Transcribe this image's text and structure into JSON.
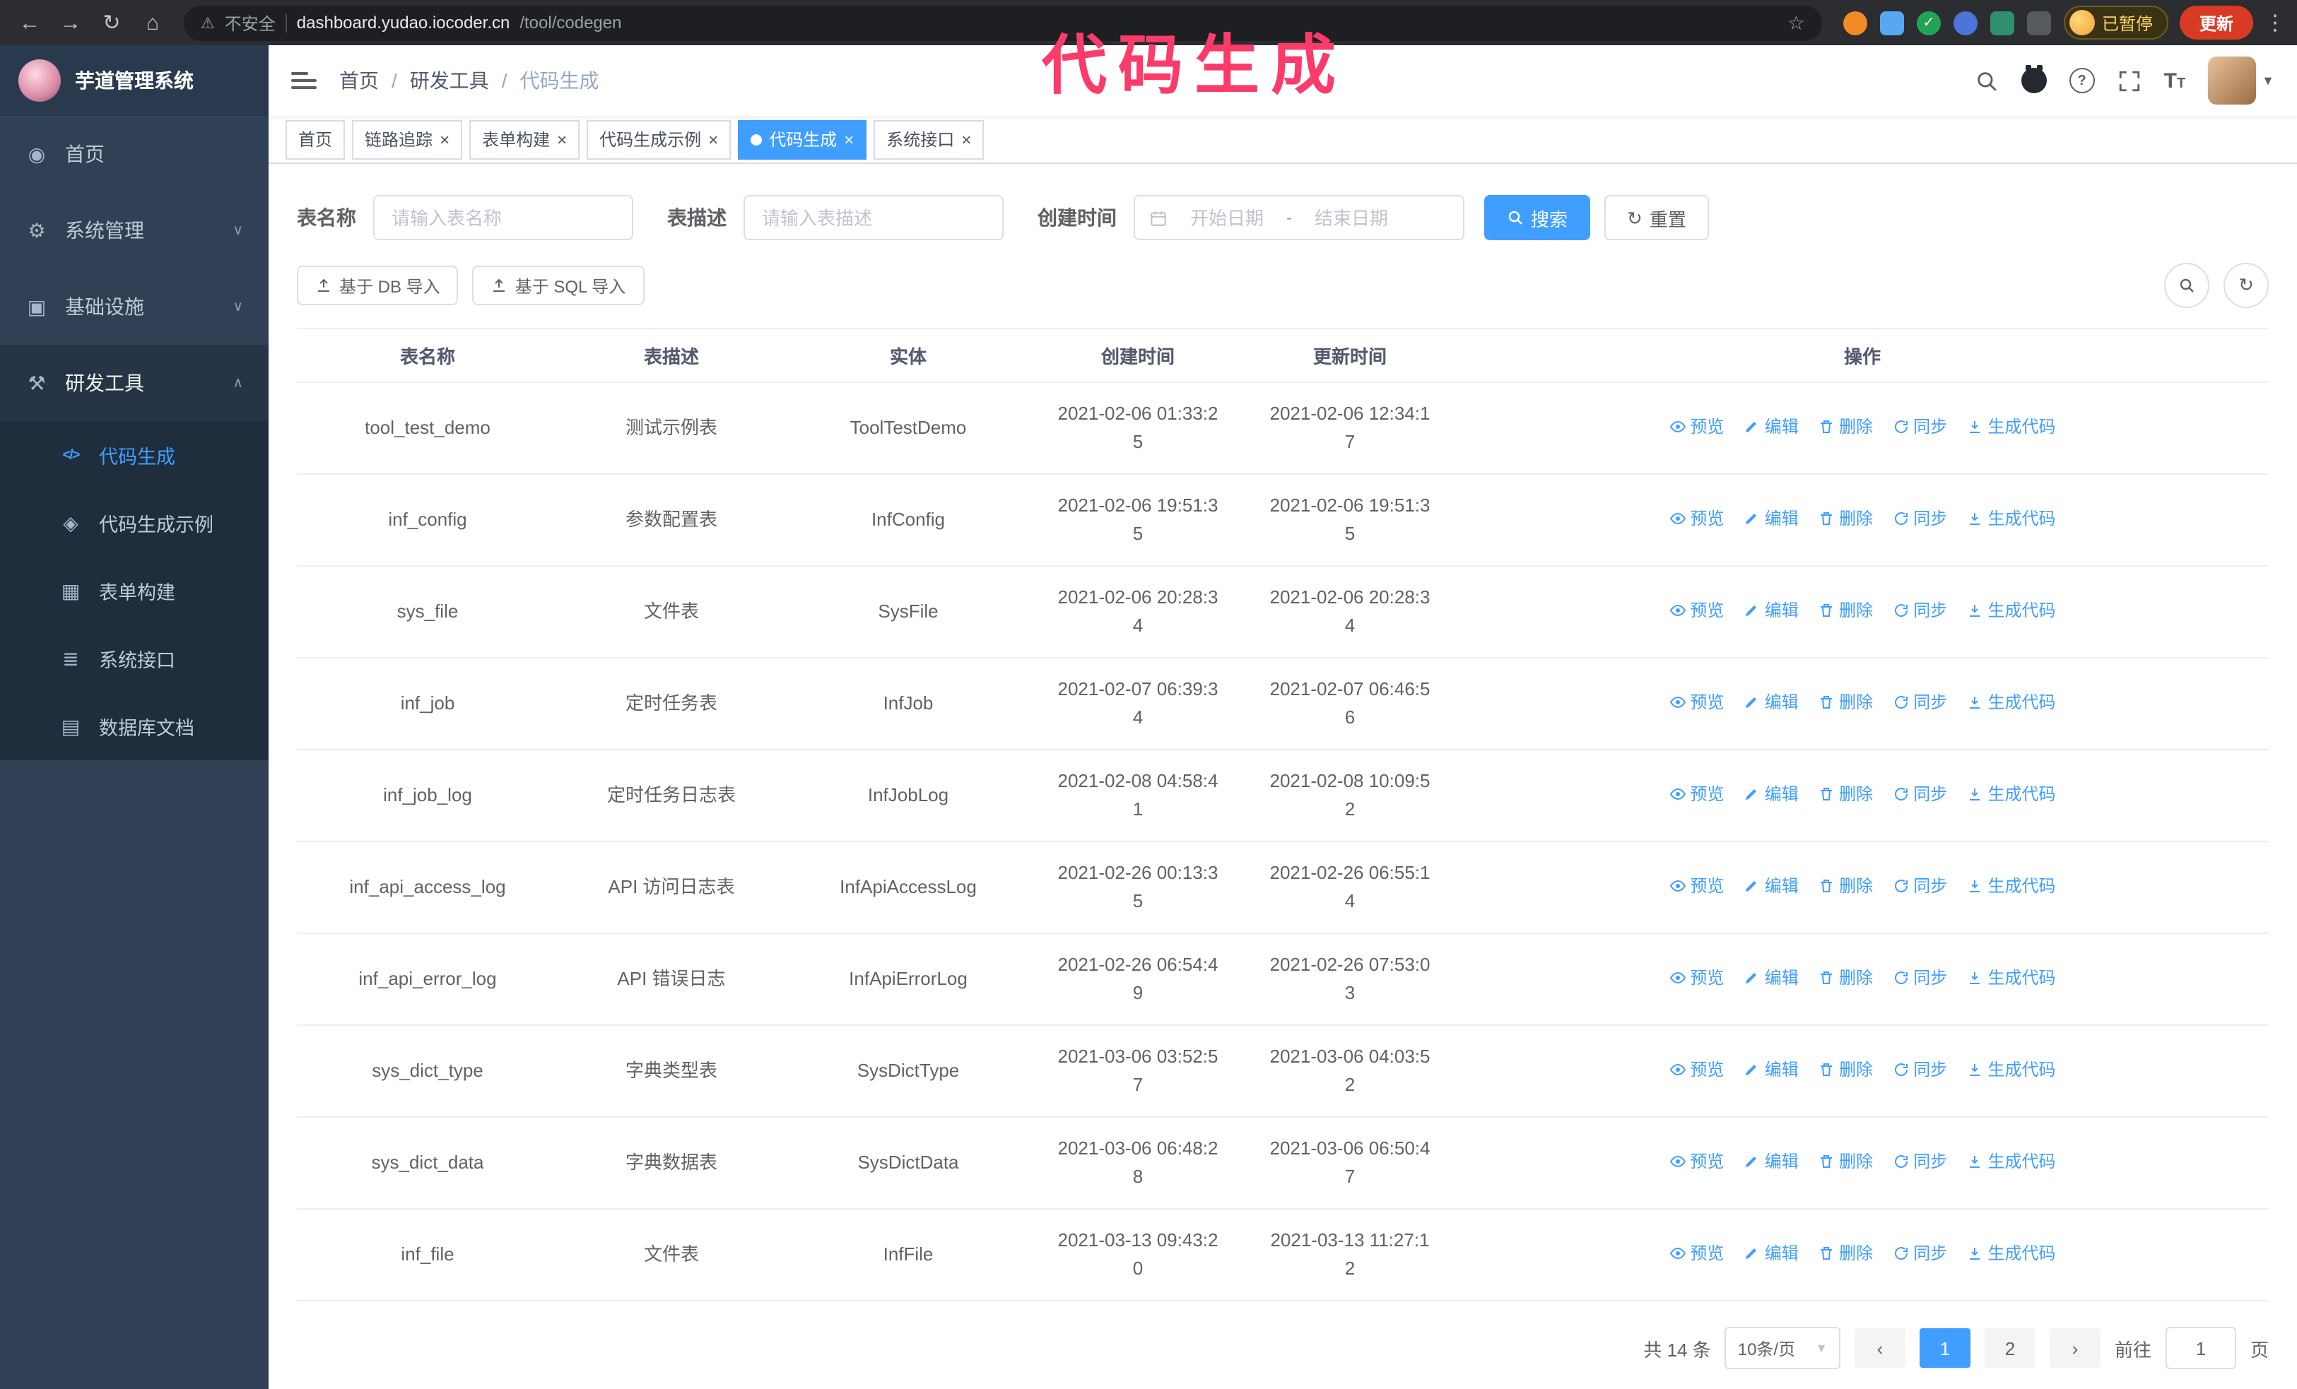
{
  "colors": {
    "accent": "#409EFF",
    "annotation_pink": "#FB3B6A",
    "sidebar_bg": "#304156",
    "submenu_bg": "#1F2D3D",
    "update_button_red": "#D93A23",
    "paused_badge_yellow": "#FDD663"
  },
  "annotation": {
    "text": "代码生成"
  },
  "browser": {
    "back_icon": "←",
    "forward_icon": "→",
    "reload_icon": "↻",
    "home_icon": "⌂",
    "warning_icon": "⚠",
    "security_warning": "不安全",
    "url_host": "dashboard.yudao.iocoder.cn",
    "url_path": "/tool/codegen",
    "bookmark_icon": "☆",
    "paused_badge": "已暂停",
    "update_button": "更新",
    "menu_icon": "⋮"
  },
  "sidebar": {
    "logo_title": "芋道管理系统",
    "menu": [
      {
        "label": "首页"
      },
      {
        "label": "系统管理"
      },
      {
        "label": "基础设施"
      },
      {
        "label": "研发工具"
      }
    ],
    "submenu": [
      {
        "label": "代码生成"
      },
      {
        "label": "代码生成示例"
      },
      {
        "label": "表单构建"
      },
      {
        "label": "系统接口"
      },
      {
        "label": "数据库文档"
      }
    ]
  },
  "header": {
    "breadcrumb": [
      "首页",
      "研发工具",
      "代码生成"
    ]
  },
  "tabs": [
    {
      "label": "首页"
    },
    {
      "label": "链路追踪"
    },
    {
      "label": "表单构建"
    },
    {
      "label": "代码生成示例"
    },
    {
      "label": "代码生成"
    },
    {
      "label": "系统接口"
    }
  ],
  "filters": {
    "name_label": "表名称",
    "name_placeholder": "请输入表名称",
    "desc_label": "表描述",
    "desc_placeholder": "请输入表描述",
    "time_label": "创建时间",
    "start_placeholder": "开始日期",
    "range_separator": "-",
    "end_placeholder": "结束日期",
    "search_label": "搜索",
    "reset_label": "重置"
  },
  "toolbar": {
    "import_db_label": "基于 DB 导入",
    "import_sql_label": "基于 SQL 导入"
  },
  "table": {
    "columns": [
      "表名称",
      "表描述",
      "实体",
      "创建时间",
      "更新时间",
      "操作"
    ],
    "action_labels": {
      "preview": "预览",
      "edit": "编辑",
      "delete": "删除",
      "sync": "同步",
      "generate": "生成代码"
    },
    "rows": [
      {
        "name": "tool_test_demo",
        "desc": "测试示例表",
        "entity": "ToolTestDemo",
        "created": "2021-02-06 01:33:25",
        "updated": "2021-02-06 12:34:17"
      },
      {
        "name": "inf_config",
        "desc": "参数配置表",
        "entity": "InfConfig",
        "created": "2021-02-06 19:51:35",
        "updated": "2021-02-06 19:51:35"
      },
      {
        "name": "sys_file",
        "desc": "文件表",
        "entity": "SysFile",
        "created": "2021-02-06 20:28:34",
        "updated": "2021-02-06 20:28:34"
      },
      {
        "name": "inf_job",
        "desc": "定时任务表",
        "entity": "InfJob",
        "created": "2021-02-07 06:39:34",
        "updated": "2021-02-07 06:46:56"
      },
      {
        "name": "inf_job_log",
        "desc": "定时任务日志表",
        "entity": "InfJobLog",
        "created": "2021-02-08 04:58:41",
        "updated": "2021-02-08 10:09:52"
      },
      {
        "name": "inf_api_access_log",
        "desc": "API 访问日志表",
        "entity": "InfApiAccessLog",
        "created": "2021-02-26 00:13:35",
        "updated": "2021-02-26 06:55:14"
      },
      {
        "name": "inf_api_error_log",
        "desc": "API 错误日志",
        "entity": "InfApiErrorLog",
        "created": "2021-02-26 06:54:49",
        "updated": "2021-02-26 07:53:03"
      },
      {
        "name": "sys_dict_type",
        "desc": "字典类型表",
        "entity": "SysDictType",
        "created": "2021-03-06 03:52:57",
        "updated": "2021-03-06 04:03:52"
      },
      {
        "name": "sys_dict_data",
        "desc": "字典数据表",
        "entity": "SysDictData",
        "created": "2021-03-06 06:48:28",
        "updated": "2021-03-06 06:50:47"
      },
      {
        "name": "inf_file",
        "desc": "文件表",
        "entity": "InfFile",
        "created": "2021-03-13 09:43:20",
        "updated": "2021-03-13 11:27:12"
      }
    ]
  },
  "pagination": {
    "total_label": "共 14 条",
    "page_size_label": "10条/页",
    "prev_icon": "‹",
    "next_icon": "›",
    "pages": [
      "1",
      "2"
    ],
    "goto_label": "前往",
    "goto_value": "1",
    "unit_label": "页"
  }
}
